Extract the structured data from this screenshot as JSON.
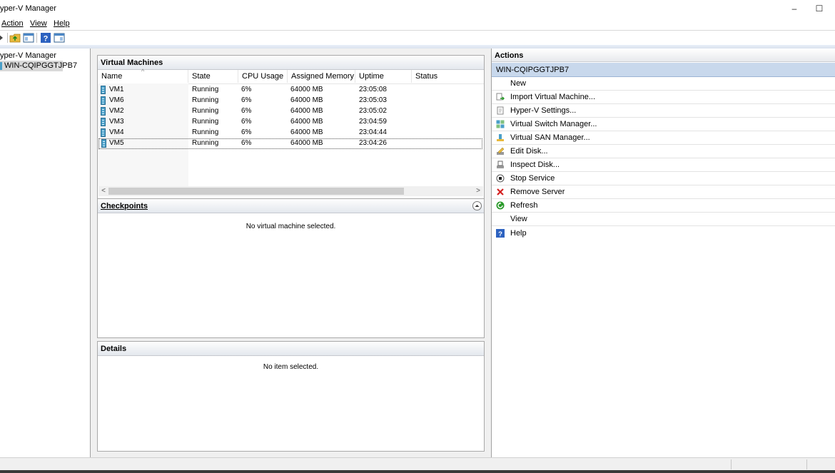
{
  "window": {
    "title": "yper-V Manager",
    "minimize_glyph": "–",
    "maximize_glyph": "☐"
  },
  "menu": [
    {
      "label": "Action"
    },
    {
      "label": "View"
    },
    {
      "label": "Help"
    }
  ],
  "tree": {
    "root": "yper-V Manager",
    "server": "WIN-CQIPGGTJPB7"
  },
  "vm_panel": {
    "title": "Virtual Machines",
    "columns": [
      "Name",
      "State",
      "CPU Usage",
      "Assigned Memory",
      "Uptime",
      "Status"
    ],
    "rows": [
      {
        "name": "VM1",
        "state": "Running",
        "cpu": "6%",
        "memory": "64000 MB",
        "uptime": "23:05:08",
        "status": ""
      },
      {
        "name": "VM6",
        "state": "Running",
        "cpu": "6%",
        "memory": "64000 MB",
        "uptime": "23:05:03",
        "status": ""
      },
      {
        "name": "VM2",
        "state": "Running",
        "cpu": "6%",
        "memory": "64000 MB",
        "uptime": "23:05:02",
        "status": ""
      },
      {
        "name": "VM3",
        "state": "Running",
        "cpu": "6%",
        "memory": "64000 MB",
        "uptime": "23:04:59",
        "status": ""
      },
      {
        "name": "VM4",
        "state": "Running",
        "cpu": "6%",
        "memory": "64000 MB",
        "uptime": "23:04:44",
        "status": ""
      },
      {
        "name": "VM5",
        "state": "Running",
        "cpu": "6%",
        "memory": "64000 MB",
        "uptime": "23:04:26",
        "status": ""
      }
    ],
    "selected_row": "VM5"
  },
  "checkpoints_panel": {
    "title": "Checkpoints",
    "empty_text": "No virtual machine selected."
  },
  "details_panel": {
    "title": "Details",
    "empty_text": "No item selected."
  },
  "actions": {
    "title": "Actions",
    "server": "WIN-CQIPGGTJPB7",
    "items": [
      {
        "label": "New",
        "icon": "none"
      },
      {
        "label": "Import Virtual Machine...",
        "icon": "import-icon"
      },
      {
        "label": "Hyper-V Settings...",
        "icon": "settings-page-icon"
      },
      {
        "label": "Virtual Switch Manager...",
        "icon": "switch-icon"
      },
      {
        "label": "Virtual SAN Manager...",
        "icon": "san-icon"
      },
      {
        "label": "Edit Disk...",
        "icon": "edit-disk-icon"
      },
      {
        "label": "Inspect Disk...",
        "icon": "inspect-disk-icon"
      },
      {
        "label": "Stop Service",
        "icon": "stop-icon"
      },
      {
        "label": "Remove Server",
        "icon": "remove-x-icon"
      },
      {
        "label": "Refresh",
        "icon": "refresh-icon"
      },
      {
        "label": "View",
        "icon": "none"
      },
      {
        "label": "Help",
        "icon": "help-icon"
      }
    ]
  },
  "colors": {
    "selection": "#c8d8ec",
    "vm_icon": "#4a9fc8",
    "remove_red": "#d42020",
    "refresh_green": "#2a9a2a",
    "help_blue": "#2d62c0"
  }
}
